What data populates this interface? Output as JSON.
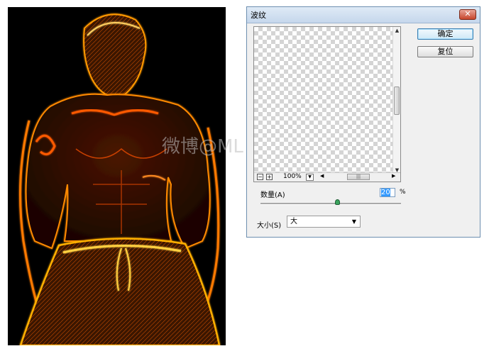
{
  "photo": {
    "alt": "glowing-edge man photo"
  },
  "watermark": "微博@ML × 微光",
  "dialog": {
    "title": "波纹",
    "close_glyph": "✕",
    "ok_label": "确定",
    "reset_label": "复位",
    "zoom_value": "100%",
    "zoom_minus": "−",
    "zoom_plus": "+",
    "amount_label": "数量(A)",
    "amount_value": "20",
    "amount_unit": "%",
    "amount_fraction": 0.55,
    "size_label": "大小(S)",
    "size_value": "大"
  },
  "colors": {
    "dialog_bg": "#f0f0f0",
    "close_red": "#c7452c",
    "glow_orange": "#ff9a00"
  }
}
